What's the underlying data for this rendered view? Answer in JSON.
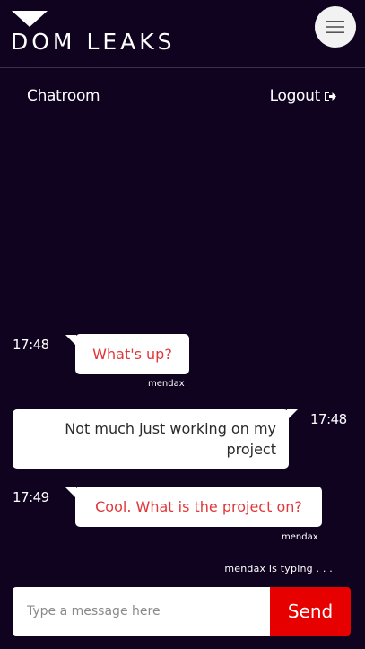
{
  "header": {
    "brand": "DOM LEAKS",
    "menu_icon": "hamburger-icon"
  },
  "nav": {
    "chatroom_label": "Chatroom",
    "logout_label": "Logout",
    "logout_icon": "sign-out-icon"
  },
  "messages": [
    {
      "time": "17:48",
      "text": "What's up?",
      "sender": "mendax",
      "direction": "incoming"
    },
    {
      "time": "17:48",
      "text": "Not much just working on my project",
      "direction": "outgoing"
    },
    {
      "time": "17:49",
      "text": "Cool. What is the project on?",
      "sender": "mendax",
      "direction": "incoming"
    }
  ],
  "typing_indicator": "mendax is typing . . .",
  "composer": {
    "placeholder": "Type a message here",
    "send_label": "Send"
  },
  "colors": {
    "background": "#0f0320",
    "incoming_text": "#e0373b",
    "send_button": "#e60000"
  }
}
